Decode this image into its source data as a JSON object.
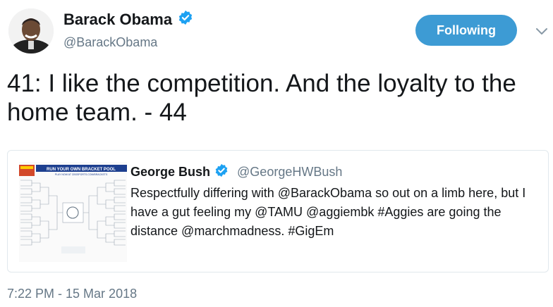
{
  "author": {
    "name": "Barack Obama",
    "handle": "@BarackObama",
    "verified": true
  },
  "follow_button": {
    "label": "Following",
    "color": "#3d9bd4"
  },
  "menu_icon": "chevron-down-icon",
  "tweet": {
    "text": "41: I like the competition. And the loyalty to the home team. - 44",
    "timestamp": "7:22 PM - 15 Mar 2018"
  },
  "quoted_tweet": {
    "name": "George Bush",
    "handle": "@GeorgeHWBush",
    "verified": true,
    "text": "Respectfully differing with @BarackObama so out on a limb here, but I have a gut feeling my @TAMU @aggiembk #Aggies are going the distance @marchmadness. #GigEm",
    "image": {
      "header_text": "RUN YOUR OWN BRACKET POOL",
      "subheader_text": "PLAY NOW AT CBSSPORTS.COM/BRACKETS"
    }
  },
  "colors": {
    "verified_badge": "#1da1f2",
    "secondary_text": "#657786",
    "border": "#e1e8ed"
  }
}
